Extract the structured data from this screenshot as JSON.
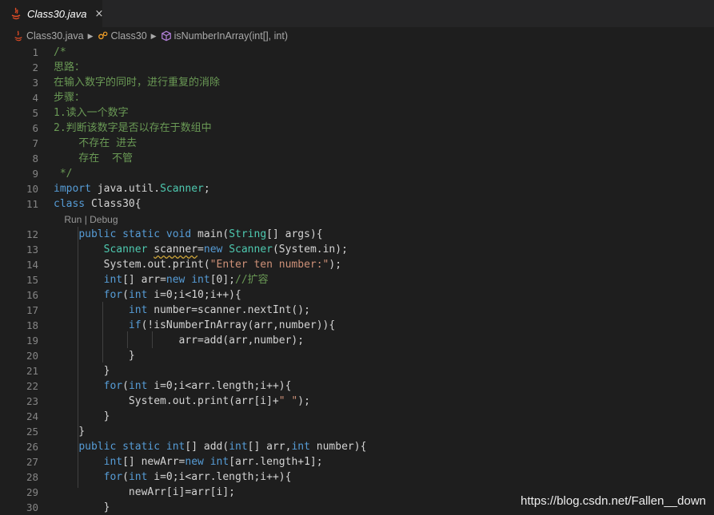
{
  "tab": {
    "title": "Class30.java",
    "close": "×"
  },
  "breadcrumb": {
    "file": "Class30.java",
    "class": "Class30",
    "method": "isNumberInArray(int[], int)"
  },
  "editor": {
    "line_numbers": [
      "1",
      "2",
      "3",
      "4",
      "5",
      "6",
      "7",
      "8",
      "9",
      "10",
      "11",
      "12",
      "13",
      "14",
      "15",
      "16",
      "17",
      "18",
      "19",
      "20",
      "21",
      "22",
      "23",
      "24",
      "25",
      "26",
      "27",
      "28",
      "29",
      "30"
    ],
    "codelens": "Run | Debug",
    "lines": [
      "/*",
      "思路：",
      "在输入数字的同时，进行重复的消除",
      "步骤：",
      "1.读入一个数字",
      "2.判断该数字是否以存在于数组中",
      "    不存在 进去",
      "    存在  不管",
      " */",
      "import java.util.Scanner;",
      "class Class30{",
      "    public static void main(String[] args){",
      "        Scanner scanner=new Scanner(System.in);",
      "        System.out.print(\"Enter ten number:\");",
      "        int[] arr=new int[0];//扩容",
      "        for(int i=0;i<10;i++){",
      "            int number=scanner.nextInt();",
      "            if(!isNumberInArray(arr,number)){",
      "                    arr=add(arr,number);",
      "            }",
      "        }",
      "        for(int i=0;i<arr.length;i++){",
      "            System.out.print(arr[i]+\" \");",
      "        }",
      "    }",
      "    public static int[] add(int[] arr,int number){",
      "        int[] newArr=new int[arr.length+1];",
      "        for(int i=0;i<arr.length;i++){",
      "            newArr[i]=arr[i];",
      "        }"
    ]
  },
  "watermark": "https://blog.csdn.net/Fallen__down",
  "colors": {
    "background": "#1e1e1e",
    "keyword": "#569cd6",
    "type": "#4ec9b0",
    "string": "#ce9178",
    "comment": "#6a9955",
    "number": "#b5cea8"
  }
}
